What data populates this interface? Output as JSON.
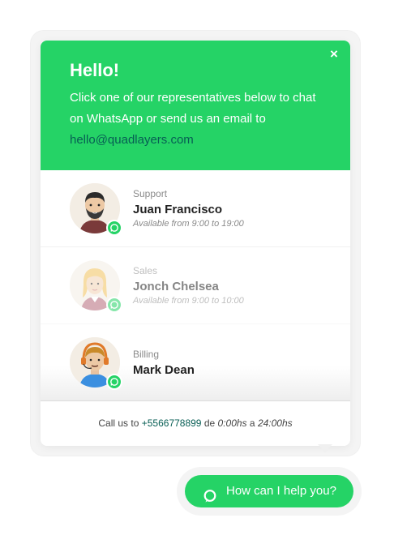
{
  "colors": {
    "accent": "#25d366",
    "link": "#075e54"
  },
  "header": {
    "title": "Hello!",
    "text": "Click one of our representatives below to chat on WhatsApp or send us an email to",
    "email": "hello@quadlayers.com",
    "close_icon": "close-icon"
  },
  "agents": [
    {
      "role": "Support",
      "name": "Juan Francisco",
      "availability": "Available from 9:00 to 19:00",
      "state": "available"
    },
    {
      "role": "Sales",
      "name": "Jonch Chelsea",
      "availability": "Available from 9:00 to 10:00",
      "state": "unavailable"
    },
    {
      "role": "Billing",
      "name": "Mark Dean",
      "availability": "",
      "state": "available"
    }
  ],
  "footer": {
    "prefix": "Call us to",
    "phone": "+5566778899",
    "middle": "de",
    "time_from": "0:00hs",
    "connector": "a",
    "time_to": "24:00hs"
  },
  "cta": {
    "label": "How can I help you?",
    "icon": "chat-bubble-icon"
  }
}
